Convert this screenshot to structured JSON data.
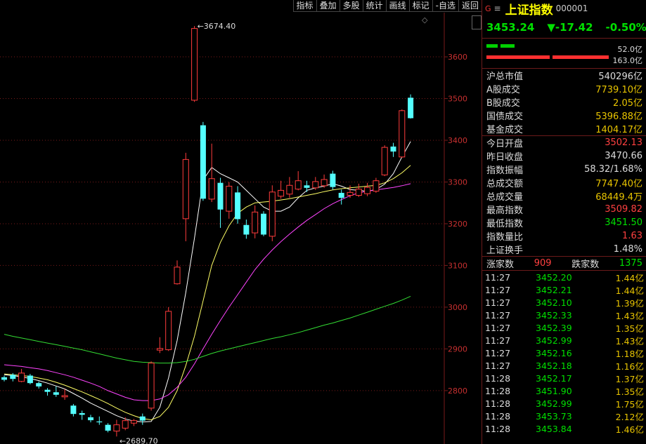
{
  "toolbar": [
    "指标",
    "叠加",
    "多股",
    "统计",
    "画线",
    "标记",
    "-自选",
    "返回"
  ],
  "header": {
    "g": "G",
    "menu": "≡",
    "name": "上证指数",
    "code": "000001"
  },
  "quote": {
    "price": "3453.24",
    "change": "▼-17.42",
    "pct": "-0.50%"
  },
  "bars": {
    "green_val": "52.0亿",
    "red_val": "163.0亿"
  },
  "market": [
    {
      "label": "沪总市值",
      "value": "540296亿",
      "color": "white"
    },
    {
      "label": "A股成交",
      "value": "7739.10亿",
      "color": "yellow"
    },
    {
      "label": "B股成交",
      "value": "2.05亿",
      "color": "yellow"
    },
    {
      "label": "国债成交",
      "value": "5396.88亿",
      "color": "yellow"
    },
    {
      "label": "基金成交",
      "value": "1404.17亿",
      "color": "yellow"
    }
  ],
  "stats": [
    {
      "label": "今日开盘",
      "value": "3502.13",
      "color": "red"
    },
    {
      "label": "昨日收盘",
      "value": "3470.66",
      "color": "white"
    },
    {
      "label": "指数振幅",
      "value": "58.32/1.68%",
      "color": "white"
    },
    {
      "label": "总成交额",
      "value": "7747.40亿",
      "color": "yellow"
    },
    {
      "label": "总成交量",
      "value": "68449.4万",
      "color": "yellow"
    },
    {
      "label": "最高指数",
      "value": "3509.82",
      "color": "red"
    },
    {
      "label": "最低指数",
      "value": "3451.50",
      "color": "green"
    },
    {
      "label": "指数量比",
      "value": "1.63",
      "color": "red"
    },
    {
      "label": "上证换手",
      "value": "1.48%",
      "color": "white"
    }
  ],
  "breadth": {
    "up_label": "涨家数",
    "up": "909",
    "down_label": "跌家数",
    "down": "1375"
  },
  "ticks": [
    {
      "time": "11:27",
      "price": "3452.20",
      "vol": "1.44亿"
    },
    {
      "time": "11:27",
      "price": "3452.21",
      "vol": "1.44亿"
    },
    {
      "time": "11:27",
      "price": "3452.10",
      "vol": "1.39亿"
    },
    {
      "time": "11:27",
      "price": "3452.33",
      "vol": "1.43亿"
    },
    {
      "time": "11:27",
      "price": "3452.39",
      "vol": "1.35亿"
    },
    {
      "time": "11:27",
      "price": "3452.99",
      "vol": "1.43亿"
    },
    {
      "time": "11:27",
      "price": "3452.16",
      "vol": "1.18亿"
    },
    {
      "time": "11:27",
      "price": "3452.18",
      "vol": "1.16亿"
    },
    {
      "time": "11:28",
      "price": "3452.17",
      "vol": "1.37亿"
    },
    {
      "time": "11:28",
      "price": "3451.90",
      "vol": "1.35亿"
    },
    {
      "time": "11:28",
      "price": "3452.99",
      "vol": "1.75亿"
    },
    {
      "time": "11:28",
      "price": "3453.73",
      "vol": "2.12亿"
    },
    {
      "time": "11:28",
      "price": "3453.84",
      "vol": "1.46亿"
    }
  ],
  "chart_data": {
    "type": "candlestick",
    "y_ticks": [
      2800,
      2900,
      3000,
      3100,
      3200,
      3300,
      3400,
      3500,
      3600
    ],
    "ylim": [
      2672,
      3706
    ],
    "annotations": {
      "high": "3674.40",
      "low": "2689.70"
    },
    "candles": [
      {
        "o": 2832,
        "c": 2826,
        "h": 2836,
        "l": 2822
      },
      {
        "o": 2838,
        "c": 2828,
        "h": 2842,
        "l": 2822
      },
      {
        "o": 2822,
        "c": 2842,
        "h": 2852,
        "l": 2820
      },
      {
        "o": 2836,
        "c": 2818,
        "h": 2840,
        "l": 2815
      },
      {
        "o": 2818,
        "c": 2810,
        "h": 2822,
        "l": 2805
      },
      {
        "o": 2802,
        "c": 2797,
        "h": 2806,
        "l": 2788
      },
      {
        "o": 2796,
        "c": 2790,
        "h": 2810,
        "l": 2785
      },
      {
        "o": 2785,
        "c": 2788,
        "h": 2804,
        "l": 2778
      },
      {
        "o": 2764,
        "c": 2744,
        "h": 2768,
        "l": 2738
      },
      {
        "o": 2746,
        "c": 2742,
        "h": 2752,
        "l": 2730
      },
      {
        "o": 2736,
        "c": 2729,
        "h": 2742,
        "l": 2724
      },
      {
        "o": 2726,
        "c": 2724,
        "h": 2738,
        "l": 2718
      },
      {
        "o": 2718,
        "c": 2704,
        "h": 2722,
        "l": 2700
      },
      {
        "o": 2703,
        "c": 2718,
        "h": 2730,
        "l": 2690
      },
      {
        "o": 2710,
        "c": 2728,
        "h": 2736,
        "l": 2705
      },
      {
        "o": 2722,
        "c": 2728,
        "h": 2732,
        "l": 2715
      },
      {
        "o": 2738,
        "c": 2728,
        "h": 2745,
        "l": 2718
      },
      {
        "o": 2758,
        "c": 2866,
        "h": 2870,
        "l": 2752
      },
      {
        "o": 2897,
        "c": 2901,
        "h": 2928,
        "l": 2890
      },
      {
        "o": 2898,
        "c": 2990,
        "h": 3000,
        "l": 2895
      },
      {
        "o": 3056,
        "c": 3096,
        "h": 3112,
        "l": 3054
      },
      {
        "o": 3212,
        "c": 3354,
        "h": 3370,
        "l": 3158
      },
      {
        "o": 3496,
        "c": 3668,
        "h": 3674,
        "l": 3492
      },
      {
        "o": 3436,
        "c": 3260,
        "h": 3444,
        "l": 3255
      },
      {
        "o": 3259,
        "c": 3308,
        "h": 3392,
        "l": 3252
      },
      {
        "o": 3298,
        "c": 3234,
        "h": 3310,
        "l": 3190
      },
      {
        "o": 3230,
        "c": 3290,
        "h": 3300,
        "l": 3212
      },
      {
        "o": 3275,
        "c": 3211,
        "h": 3290,
        "l": 3200
      },
      {
        "o": 3197,
        "c": 3174,
        "h": 3210,
        "l": 3164
      },
      {
        "o": 3178,
        "c": 3228,
        "h": 3244,
        "l": 3165
      },
      {
        "o": 3224,
        "c": 3174,
        "h": 3230,
        "l": 3170
      },
      {
        "o": 3170,
        "c": 3276,
        "h": 3292,
        "l": 3158
      },
      {
        "o": 3266,
        "c": 3280,
        "h": 3303,
        "l": 3260
      },
      {
        "o": 3271,
        "c": 3292,
        "h": 3312,
        "l": 3262
      },
      {
        "o": 3283,
        "c": 3303,
        "h": 3326,
        "l": 3280
      },
      {
        "o": 3292,
        "c": 3286,
        "h": 3303,
        "l": 3276
      },
      {
        "o": 3286,
        "c": 3301,
        "h": 3312,
        "l": 3281
      },
      {
        "o": 3291,
        "c": 3306,
        "h": 3318,
        "l": 3286
      },
      {
        "o": 3320,
        "c": 3288,
        "h": 3327,
        "l": 3282
      },
      {
        "o": 3274,
        "c": 3262,
        "h": 3282,
        "l": 3246
      },
      {
        "o": 3268,
        "c": 3275,
        "h": 3292,
        "l": 3262
      },
      {
        "o": 3268,
        "c": 3283,
        "h": 3296,
        "l": 3264
      },
      {
        "o": 3272,
        "c": 3287,
        "h": 3298,
        "l": 3266
      },
      {
        "o": 3278,
        "c": 3303,
        "h": 3310,
        "l": 3274
      },
      {
        "o": 3317,
        "c": 3383,
        "h": 3388,
        "l": 3314
      },
      {
        "o": 3385,
        "c": 3373,
        "h": 3394,
        "l": 3360
      },
      {
        "o": 3360,
        "c": 3471,
        "h": 3474,
        "l": 3358
      },
      {
        "o": 3502,
        "c": 3453,
        "h": 3510,
        "l": 3452
      }
    ],
    "series": [
      {
        "color": "#ffffff",
        "values": [
          2838,
          2836,
          2833,
          2829,
          2824,
          2818,
          2811,
          2804,
          2793,
          2782,
          2770,
          2760,
          2750,
          2740,
          2732,
          2727,
          2725,
          2726,
          2760,
          2830,
          2920,
          3035,
          3165,
          3305,
          3335,
          3320,
          3310,
          3300,
          3280,
          3260,
          3240,
          3230,
          3230,
          3240,
          3262,
          3280,
          3286,
          3290,
          3296,
          3290,
          3282,
          3280,
          3278,
          3282,
          3295,
          3320,
          3360,
          3397
        ]
      },
      {
        "color": "#ffff66",
        "values": [
          2840,
          2838,
          2836,
          2834,
          2830,
          2826,
          2820,
          2813,
          2805,
          2797,
          2788,
          2779,
          2769,
          2758,
          2748,
          2740,
          2733,
          2730,
          2738,
          2760,
          2800,
          2860,
          2930,
          3015,
          3100,
          3155,
          3195,
          3225,
          3240,
          3250,
          3252,
          3254,
          3257,
          3260,
          3264,
          3268,
          3272,
          3277,
          3281,
          3284,
          3286,
          3288,
          3290,
          3292,
          3298,
          3308,
          3322,
          3340
        ]
      },
      {
        "color": "#ff44ff",
        "values": [
          2862,
          2860,
          2858,
          2855,
          2852,
          2848,
          2843,
          2838,
          2832,
          2825,
          2818,
          2810,
          2800,
          2792,
          2784,
          2778,
          2776,
          2776,
          2780,
          2790,
          2808,
          2832,
          2864,
          2900,
          2935,
          2968,
          3000,
          3030,
          3060,
          3090,
          3115,
          3137,
          3157,
          3175,
          3192,
          3208,
          3222,
          3236,
          3248,
          3258,
          3267,
          3274,
          3278,
          3281,
          3284,
          3287,
          3291,
          3296
        ]
      },
      {
        "color": "#33dd33",
        "values": [
          2935,
          2930,
          2926,
          2922,
          2918,
          2914,
          2910,
          2906,
          2902,
          2898,
          2893,
          2888,
          2883,
          2878,
          2874,
          2870,
          2868,
          2867,
          2866,
          2866,
          2867,
          2870,
          2875,
          2882,
          2889,
          2895,
          2900,
          2905,
          2910,
          2915,
          2920,
          2925,
          2929,
          2934,
          2939,
          2945,
          2951,
          2957,
          2962,
          2968,
          2974,
          2981,
          2988,
          2995,
          3002,
          3009,
          3017,
          3026
        ]
      }
    ]
  }
}
